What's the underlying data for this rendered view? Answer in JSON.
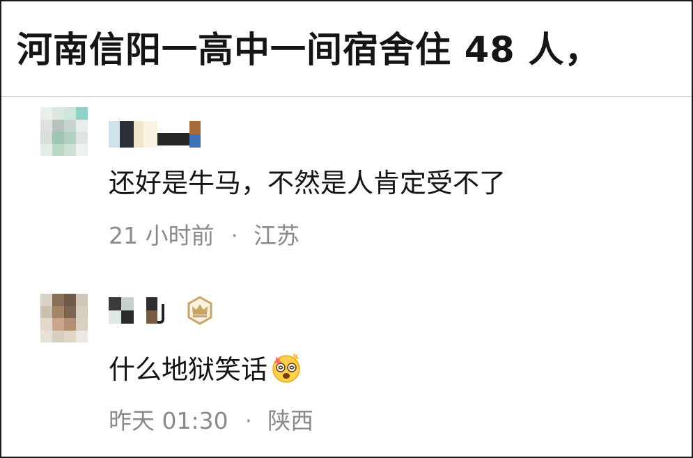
{
  "headline": {
    "text": "河南信阳一高中一间宿舍住 48 人，"
  },
  "comments": [
    {
      "username": "",
      "text": "还好是牛马，不然是人肯定受不了",
      "time": "21 小时前",
      "separator": "·",
      "location": "江苏",
      "avatar_icon": "pixelated-avatar-icon"
    },
    {
      "username": "",
      "text": "什么地狱笑话",
      "emoji": "dizzy-face-emoji",
      "badge_icon": "crown-badge-icon",
      "time": "昨天 01:30",
      "separator": "·",
      "location": "陕西",
      "avatar_icon": "pixelated-avatar-icon"
    }
  ],
  "colors": {
    "headline": "#151515",
    "comment_text": "#141414",
    "meta_text": "#8a8a8a",
    "badge_gold": "#c9a465",
    "divider": "#d6d6d6"
  }
}
